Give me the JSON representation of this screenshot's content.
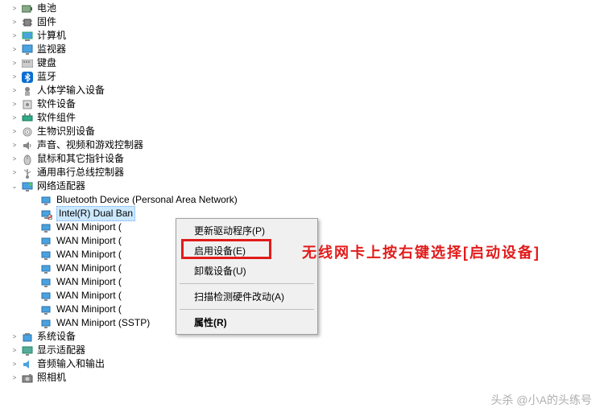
{
  "tree": {
    "top_categories": [
      {
        "label": "电池",
        "icon": "battery"
      },
      {
        "label": "固件",
        "icon": "chip"
      },
      {
        "label": "计算机",
        "icon": "computer"
      },
      {
        "label": "监视器",
        "icon": "monitor"
      },
      {
        "label": "键盘",
        "icon": "keyboard"
      },
      {
        "label": "蓝牙",
        "icon": "bluetooth"
      },
      {
        "label": "人体学输入设备",
        "icon": "hid"
      },
      {
        "label": "软件设备",
        "icon": "software"
      },
      {
        "label": "软件组件",
        "icon": "component"
      },
      {
        "label": "生物识别设备",
        "icon": "biometric"
      },
      {
        "label": "声音、视频和游戏控制器",
        "icon": "sound"
      },
      {
        "label": "鼠标和其它指针设备",
        "icon": "mouse"
      },
      {
        "label": "通用串行总线控制器",
        "icon": "usb"
      }
    ],
    "network_adapter": {
      "label": "网络适配器",
      "icon": "network",
      "children": [
        {
          "label": "Bluetooth Device (Personal Area Network)",
          "icon": "adapter"
        },
        {
          "label": "Intel(R) Dual Ban",
          "icon": "adapter-disabled",
          "selected": true
        },
        {
          "label": "WAN Miniport (",
          "icon": "adapter"
        },
        {
          "label": "WAN Miniport (",
          "icon": "adapter"
        },
        {
          "label": "WAN Miniport (",
          "icon": "adapter"
        },
        {
          "label": "WAN Miniport (",
          "icon": "adapter"
        },
        {
          "label": "WAN Miniport (",
          "icon": "adapter"
        },
        {
          "label": "WAN Miniport (",
          "icon": "adapter"
        },
        {
          "label": "WAN Miniport (",
          "icon": "adapter"
        },
        {
          "label": "WAN Miniport (SSTP)",
          "icon": "adapter"
        }
      ]
    },
    "bottom_categories": [
      {
        "label": "系统设备",
        "icon": "system"
      },
      {
        "label": "显示适配器",
        "icon": "display"
      },
      {
        "label": "音频输入和输出",
        "icon": "audio"
      },
      {
        "label": "照相机",
        "icon": "camera"
      }
    ]
  },
  "context_menu": {
    "items": [
      {
        "label": "更新驱动程序(P)",
        "key": "update"
      },
      {
        "label": "启用设备(E)",
        "key": "enable"
      },
      {
        "label": "卸载设备(U)",
        "key": "uninstall"
      },
      {
        "sep": true
      },
      {
        "label": "扫描检测硬件改动(A)",
        "key": "scan"
      },
      {
        "sep": true
      },
      {
        "label": "属性(R)",
        "key": "properties",
        "bold": true
      }
    ]
  },
  "annotation_text": "无线网卡上按右键选择[启动设备]",
  "watermark_text": "头杀 @小A的头练号"
}
